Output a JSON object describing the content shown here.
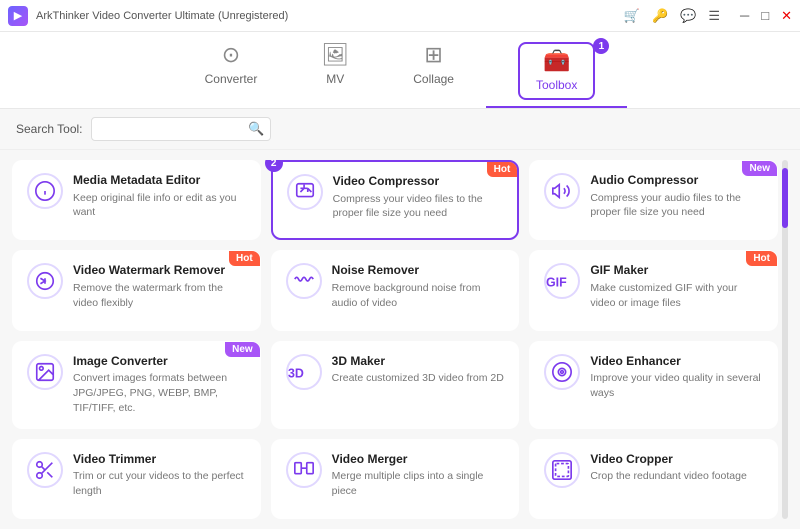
{
  "titlebar": {
    "app_name": "ArkThinker Video Converter Ultimate (Unregistered)"
  },
  "nav": {
    "tabs": [
      {
        "id": "converter",
        "label": "Converter",
        "icon": "⊙"
      },
      {
        "id": "mv",
        "label": "MV",
        "icon": "🖼"
      },
      {
        "id": "collage",
        "label": "Collage",
        "icon": "⊞"
      },
      {
        "id": "toolbox",
        "label": "Toolbox",
        "icon": "🧰",
        "active": true,
        "badge": "1"
      }
    ]
  },
  "search": {
    "label": "Search Tool:",
    "placeholder": ""
  },
  "tools": [
    {
      "id": "media-metadata-editor",
      "name": "Media Metadata Editor",
      "desc": "Keep original file info or edit as you want",
      "badge": null,
      "selected": false
    },
    {
      "id": "video-compressor",
      "name": "Video Compressor",
      "desc": "Compress your video files to the proper file size you need",
      "badge": "Hot",
      "badge_type": "hot",
      "selected": true,
      "circle_badge": "2"
    },
    {
      "id": "audio-compressor",
      "name": "Audio Compressor",
      "desc": "Compress your audio files to the proper file size you need",
      "badge": "New",
      "badge_type": "new",
      "selected": false
    },
    {
      "id": "video-watermark-remover",
      "name": "Video Watermark Remover",
      "desc": "Remove the watermark from the video flexibly",
      "badge": "Hot",
      "badge_type": "hot",
      "selected": false
    },
    {
      "id": "noise-remover",
      "name": "Noise Remover",
      "desc": "Remove background noise from audio of video",
      "badge": null,
      "selected": false
    },
    {
      "id": "gif-maker",
      "name": "GIF Maker",
      "desc": "Make customized GIF with your video or image files",
      "badge": "Hot",
      "badge_type": "hot",
      "selected": false
    },
    {
      "id": "image-converter",
      "name": "Image Converter",
      "desc": "Convert images formats between JPG/JPEG, PNG, WEBP, BMP, TIF/TIFF, etc.",
      "badge": "New",
      "badge_type": "new",
      "selected": false
    },
    {
      "id": "3d-maker",
      "name": "3D Maker",
      "desc": "Create customized 3D video from 2D",
      "badge": null,
      "selected": false
    },
    {
      "id": "video-enhancer",
      "name": "Video Enhancer",
      "desc": "Improve your video quality in several ways",
      "badge": null,
      "selected": false
    },
    {
      "id": "video-trimmer",
      "name": "Video Trimmer",
      "desc": "Trim or cut your videos to the perfect length",
      "badge": null,
      "selected": false
    },
    {
      "id": "video-merger",
      "name": "Video Merger",
      "desc": "Merge multiple clips into a single piece",
      "badge": null,
      "selected": false
    },
    {
      "id": "video-cropper",
      "name": "Video Cropper",
      "desc": "Crop the redundant video footage",
      "badge": null,
      "selected": false
    }
  ],
  "icons": {
    "media-metadata-editor": "ⓘ",
    "video-compressor": "⇄",
    "audio-compressor": "◄►",
    "video-watermark-remover": "✦",
    "noise-remover": "≋",
    "gif-maker": "GIF",
    "image-converter": "📷",
    "3d-maker": "3D",
    "video-enhancer": "🎨",
    "video-trimmer": "✂",
    "video-merger": "⊞",
    "video-cropper": "⬜"
  }
}
